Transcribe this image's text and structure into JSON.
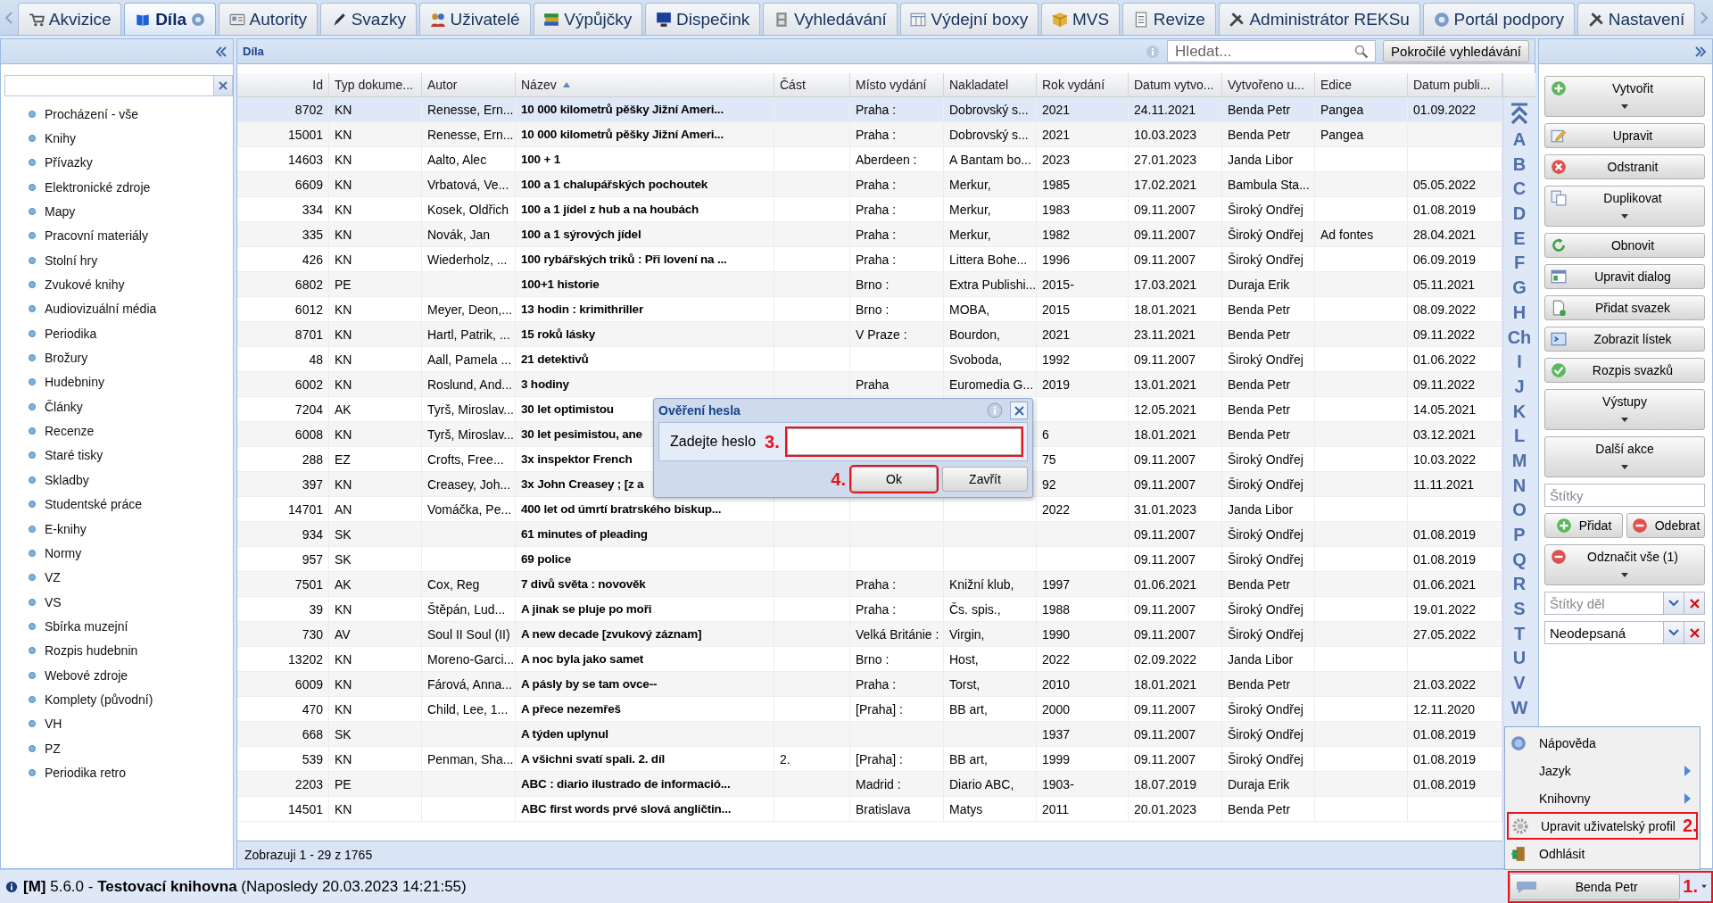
{
  "tabs": [
    {
      "label": "Akvizice",
      "selected": false
    },
    {
      "label": "Díla",
      "selected": true
    },
    {
      "label": "Autority",
      "selected": false
    },
    {
      "label": "Svazky",
      "selected": false
    },
    {
      "label": "Uživatelé",
      "selected": false
    },
    {
      "label": "Výpůjčky",
      "selected": false
    },
    {
      "label": "Dispečink",
      "selected": false
    },
    {
      "label": "Vyhledávání",
      "selected": false
    },
    {
      "label": "Výdejní boxy",
      "selected": false
    },
    {
      "label": "MVS",
      "selected": false
    },
    {
      "label": "Revize",
      "selected": false
    },
    {
      "label": "Administrátor REKSu",
      "selected": false
    },
    {
      "label": "Portál podpory",
      "selected": false
    },
    {
      "label": "Nastavení",
      "selected": false
    }
  ],
  "sidebar": {
    "items": [
      "Procházení - vše",
      "Knihy",
      "Přívazky",
      "Elektronické zdroje",
      "Mapy",
      "Pracovní materiály",
      "Stolní hry",
      "Zvukové knihy",
      "Audiovizuální média",
      "Periodika",
      "Brožury",
      "Hudebniny",
      "Články",
      "Recenze",
      "Staré tisky",
      "Skladby",
      "Studentské práce",
      "E-knihy",
      "Normy",
      "VZ",
      "VS",
      "Sbírka muzejní",
      "Rozpis hudebnin",
      "Webové zdroje",
      "Komplety (původní)",
      "VH",
      "PZ",
      "Periodika retro"
    ]
  },
  "grid": {
    "title": "Díla",
    "search": {
      "placeholder": "Hledat..."
    },
    "advanced_button": "Pokročilé vyhledávání",
    "columns": [
      {
        "label": "Id",
        "sorted": false
      },
      {
        "label": "Typ dokume...",
        "sorted": false
      },
      {
        "label": "Autor",
        "sorted": false
      },
      {
        "label": "Název",
        "sorted": true
      },
      {
        "label": "Část",
        "sorted": false
      },
      {
        "label": "Místo vydání",
        "sorted": false
      },
      {
        "label": "Nakladatel",
        "sorted": false
      },
      {
        "label": "Rok vydání",
        "sorted": false
      },
      {
        "label": "Datum vytvo...",
        "sorted": false
      },
      {
        "label": "Vytvořeno u...",
        "sorted": false
      },
      {
        "label": "Edice",
        "sorted": false
      },
      {
        "label": "Datum publi...",
        "sorted": false
      }
    ],
    "rows": [
      {
        "selected": true,
        "id": "8702",
        "type": "KN",
        "author": "Renesse, Ern...",
        "title": "10 000 kilometrů pěšky Jižní Ameri...",
        "place": "Praha :",
        "publisher": "Dobrovský s...",
        "year": "2021",
        "created": "24.11.2021",
        "creator": "Benda Petr",
        "edition": "Pangea",
        "published": "01.09.2022"
      },
      {
        "selected": false,
        "id": "15001",
        "type": "KN",
        "author": "Renesse, Ern...",
        "title": "10 000 kilometrů pěšky Jižní Ameri...",
        "place": "Praha :",
        "publisher": "Dobrovský s...",
        "year": "2021",
        "created": "10.03.2023",
        "creator": "Benda Petr",
        "edition": "Pangea"
      },
      {
        "selected": false,
        "id": "14603",
        "type": "KN",
        "author": "Aalto, Alec",
        "title": "100 + 1",
        "place": "Aberdeen :",
        "publisher": "A Bantam bo...",
        "year": "2023",
        "created": "27.01.2023",
        "creator": "Janda Libor"
      },
      {
        "selected": false,
        "id": "6609",
        "type": "KN",
        "author": "Vrbatová, Ve...",
        "title": "100 a 1 chalupářských pochoutek",
        "place": "Praha :",
        "publisher": "Merkur,",
        "year": "1985",
        "created": "17.02.2021",
        "creator": "Bambula Sta...",
        "published": "05.05.2022"
      },
      {
        "selected": false,
        "id": "334",
        "type": "KN",
        "author": "Kosek, Oldřich",
        "title": "100 a 1 jídel z hub a na houbách",
        "place": "Praha :",
        "publisher": "Merkur,",
        "year": "1983",
        "created": "09.11.2007",
        "creator": "Široký Ondřej",
        "published": "01.08.2019"
      },
      {
        "selected": false,
        "id": "335",
        "type": "KN",
        "author": "Novák, Jan",
        "title": "100 a 1 sýrových jídel",
        "place": "Praha :",
        "publisher": "Merkur,",
        "year": "1982",
        "created": "09.11.2007",
        "creator": "Široký Ondřej",
        "edition": "Ad fontes",
        "published": "28.04.2021"
      },
      {
        "selected": false,
        "id": "426",
        "type": "KN",
        "author": "Wiederholz, ...",
        "title": "100 rybářských triků : Při lovení na ...",
        "place": "Praha :",
        "publisher": "Littera Bohe...",
        "year": "1996",
        "created": "09.11.2007",
        "creator": "Široký Ondřej",
        "published": "06.09.2019"
      },
      {
        "selected": false,
        "id": "6802",
        "type": "PE",
        "title": "100+1 historie",
        "place": "Brno :",
        "publisher": "Extra Publishi...",
        "year": "2015-",
        "created": "17.03.2021",
        "creator": "Duraja Erik",
        "published": "05.11.2021"
      },
      {
        "selected": false,
        "id": "6012",
        "type": "KN",
        "author": "Meyer, Deon,...",
        "title": "13 hodin : krimithriller",
        "place": "Brno :",
        "publisher": "MOBA,",
        "year": "2015",
        "created": "18.01.2021",
        "creator": "Benda Petr",
        "published": "08.09.2022"
      },
      {
        "selected": false,
        "id": "8701",
        "type": "KN",
        "author": "Hartl, Patrik, ...",
        "title": "15 roků lásky",
        "place": "V Praze :",
        "publisher": "Bourdon,",
        "year": "2021",
        "created": "23.11.2021",
        "creator": "Benda Petr",
        "published": "09.11.2022"
      },
      {
        "selected": false,
        "id": "48",
        "type": "KN",
        "author": "Aall, Pamela ...",
        "title": "21 detektivů",
        "publisher": "Svoboda,",
        "year": "1992",
        "created": "09.11.2007",
        "creator": "Široký Ondřej",
        "published": "01.06.2022"
      },
      {
        "selected": false,
        "id": "6002",
        "type": "KN",
        "author": "Roslund, And...",
        "title": "3 hodiny",
        "place": "Praha",
        "publisher": "Euromedia G...",
        "year": "2019",
        "created": "13.01.2021",
        "creator": "Benda Petr",
        "published": "09.11.2022"
      },
      {
        "selected": false,
        "id": "7204",
        "type": "AK",
        "author": "Tyrš, Miroslav...",
        "title": "30 let optimistou",
        "created": "12.05.2021",
        "creator": "Benda Petr",
        "published": "14.05.2021"
      },
      {
        "selected": false,
        "id": "6008",
        "type": "KN",
        "author": "Tyrš, Miroslav...",
        "title": "30 let pesimistou, ane",
        "year": "6",
        "created": "18.01.2021",
        "creator": "Benda Petr",
        "published": "03.12.2021"
      },
      {
        "selected": false,
        "id": "288",
        "type": "EZ",
        "author": "Crofts, Free...",
        "title": "3x inspektor French",
        "year": "75",
        "created": "09.11.2007",
        "creator": "Široký Ondřej",
        "published": "10.03.2022"
      },
      {
        "selected": false,
        "id": "397",
        "type": "KN",
        "author": "Creasey, Joh...",
        "title": "3x John Creasey ; [z a",
        "year": "92",
        "created": "09.11.2007",
        "creator": "Široký Ondřej",
        "published": "11.11.2021"
      },
      {
        "selected": false,
        "id": "14701",
        "type": "AN",
        "author": "Vomáčka, Pe...",
        "title": "400 let od úmrtí bratrského biskup...",
        "year": "2022",
        "created": "31.01.2023",
        "creator": "Janda Libor"
      },
      {
        "selected": false,
        "id": "934",
        "type": "SK",
        "title": "61 minutes of pleading",
        "created": "09.11.2007",
        "creator": "Široký Ondřej",
        "published": "01.08.2019"
      },
      {
        "selected": false,
        "id": "957",
        "type": "SK",
        "title": "69 police",
        "created": "09.11.2007",
        "creator": "Široký Ondřej",
        "published": "01.08.2019"
      },
      {
        "selected": false,
        "id": "7501",
        "type": "AK",
        "author": "Cox, Reg",
        "title": "7 divů světa : novověk",
        "place": "Praha :",
        "publisher": "Knižní klub,",
        "year": "1997",
        "created": "01.06.2021",
        "creator": "Benda Petr",
        "published": "01.06.2021"
      },
      {
        "selected": false,
        "id": "39",
        "type": "KN",
        "author": "Štěpán, Lud...",
        "title": "A jinak se pluje po moři",
        "place": "Praha :",
        "publisher": "Čs. spis.,",
        "year": "1988",
        "created": "09.11.2007",
        "creator": "Široký Ondřej",
        "published": "19.01.2022"
      },
      {
        "selected": false,
        "id": "730",
        "type": "AV",
        "author": "Soul II Soul (II)",
        "title": "A new decade [zvukový záznam]",
        "place": "Velká Británie :",
        "publisher": "Virgin,",
        "year": "1990",
        "created": "09.11.2007",
        "creator": "Široký Ondřej",
        "published": "27.05.2022"
      },
      {
        "selected": false,
        "id": "13202",
        "type": "KN",
        "author": "Moreno-Garci...",
        "title": "A noc byla jako samet",
        "place": "Brno :",
        "publisher": "Host,",
        "year": "2022",
        "created": "02.09.2022",
        "creator": "Janda Libor"
      },
      {
        "selected": false,
        "id": "6009",
        "type": "KN",
        "author": "Fárová, Anna...",
        "title": "A pásly by se tam ovce--",
        "place": "Praha :",
        "publisher": "Torst,",
        "year": "2010",
        "created": "18.01.2021",
        "creator": "Benda Petr",
        "published": "21.03.2022"
      },
      {
        "selected": false,
        "id": "470",
        "type": "KN",
        "author": "Child, Lee, 1...",
        "title": "A přece nezemřeš",
        "place": "[Praha] :",
        "publisher": "BB art,",
        "year": "2000",
        "created": "09.11.2007",
        "creator": "Široký Ondřej",
        "published": "12.11.2020"
      },
      {
        "selected": false,
        "id": "668",
        "type": "SK",
        "title": "A týden uplynul",
        "year": "1937",
        "created": "09.11.2007",
        "creator": "Široký Ondřej",
        "published": "01.08.2019"
      },
      {
        "selected": false,
        "id": "539",
        "type": "KN",
        "author": "Penman, Sha...",
        "title": "A všichni svatí spali. 2. díl",
        "part": "2.",
        "place": "[Praha] :",
        "publisher": "BB art,",
        "year": "1999",
        "created": "09.11.2007",
        "creator": "Široký Ondřej",
        "published": "01.08.2019"
      },
      {
        "selected": false,
        "id": "2203",
        "type": "PE",
        "title": "ABC : diario ilustrado de informació...",
        "place": "Madrid :",
        "publisher": "Diario ABC,",
        "year": "1903-",
        "created": "18.07.2019",
        "creator": "Duraja Erik",
        "published": "01.08.2019"
      },
      {
        "selected": false,
        "id": "14501",
        "type": "KN",
        "title": "ABC first words prvé slová angličtin...",
        "place": "Bratislava",
        "publisher": "Matys",
        "year": "2011",
        "created": "20.01.2023",
        "creator": "Benda Petr"
      }
    ],
    "alphabet": [
      "A",
      "B",
      "C",
      "D",
      "E",
      "F",
      "G",
      "H",
      "Ch",
      "I",
      "J",
      "K",
      "L",
      "M",
      "N",
      "O",
      "P",
      "Q",
      "R",
      "S",
      "T",
      "U",
      "V",
      "W"
    ],
    "footer": "Zobrazuji 1 - 29 z 1765"
  },
  "actions": [
    {
      "label": "Vytvořit",
      "dropdown": true
    },
    {
      "label": "Upravit",
      "dropdown": false
    },
    {
      "label": "Odstranit",
      "dropdown": false
    },
    {
      "label": "Duplikovat",
      "dropdown": true
    },
    {
      "label": "Obnovit",
      "dropdown": false
    },
    {
      "label": "Upravit dialog",
      "dropdown": false
    },
    {
      "label": "Přidat svazek",
      "dropdown": false
    },
    {
      "label": "Zobrazit lístek",
      "dropdown": false
    },
    {
      "label": "Rozpis svazků",
      "dropdown": false
    },
    {
      "label": "Výstupy",
      "dropdown": true
    },
    {
      "label": "Další akce",
      "dropdown": true
    }
  ],
  "tags_field": {
    "placeholder": "Štítky"
  },
  "tag_buttons": [
    "Přidat",
    "Odebrat"
  ],
  "unmark_button": {
    "label": "Odznačit vše (1)",
    "dropdown": true
  },
  "filters": [
    {
      "placeholder": "Štítky děl"
    },
    {
      "value": "Neodepsaná"
    }
  ],
  "dialog": {
    "title": "Ověření hesla",
    "label": "Zadejte heslo",
    "field": {
      "callout": "3."
    },
    "buttons": [
      {
        "label": "Ok",
        "callout": "4."
      },
      {
        "label": "Zavřít"
      }
    ]
  },
  "user_menu": {
    "items": [
      {
        "label": "Nápověda",
        "submenu": false
      },
      {
        "label": "Jazyk",
        "submenu": true
      },
      {
        "label": "Knihovny",
        "submenu": true
      },
      {
        "label": "Upravit uživatelský profil",
        "submenu": false,
        "callout": "2."
      },
      {
        "label": "Odhlásit",
        "submenu": false
      }
    ]
  },
  "user_button": {
    "label": "Benda Petr",
    "callout": "1."
  },
  "status_bar": {
    "text": "**[M]** 5.6.0 - **Testovací knihovna** (Naposledy 20.03.2023 14:21:55)"
  }
}
